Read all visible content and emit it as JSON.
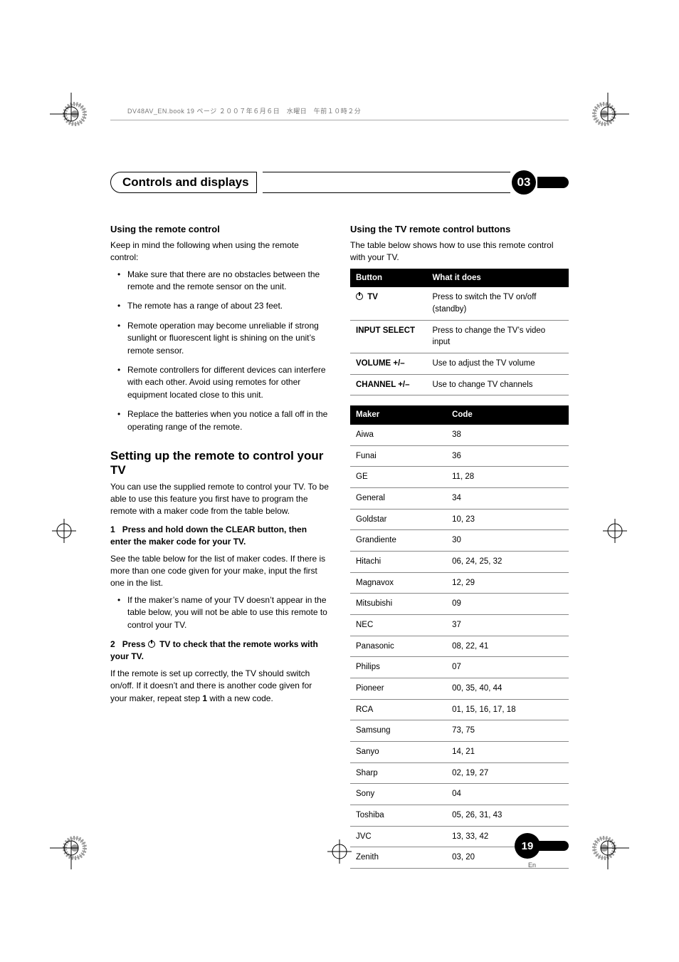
{
  "book_line": "DV48AV_EN.book  19 ページ  ２００７年６月６日　水曜日　午前１０時２分",
  "header": {
    "title": "Controls and displays",
    "chapter": "03"
  },
  "left": {
    "h_remote": "Using the remote control",
    "p_remote": "Keep in mind the following when using the remote control:",
    "bullets": [
      "Make sure that there are no obstacles between the remote and the remote sensor on the unit.",
      "The remote has a range of about 23 feet.",
      "Remote operation may become unreliable if strong sunlight or fluorescent light is shining on the unit’s remote sensor.",
      "Remote controllers for different devices can interfere with each other. Avoid using remotes for other equipment located close to this unit.",
      "Replace the batteries when you notice a fall off in the operating range of the remote."
    ],
    "h_setup": "Setting up the remote to control your TV",
    "p_setup": "You can use the supplied remote to control your TV. To be able to use this feature you first have to program the remote with a maker code from the table below.",
    "step1_num": "1",
    "step1_b": "Press and hold down the CLEAR button, then enter the maker code for your TV.",
    "step1_p": "See the table below for the list of maker codes. If there is more than one code given for your make, input the first one in the list.",
    "step1_bullet": "If the maker’s name of your TV doesn’t appear in the table below, you will not be able to use this remote to control your TV.",
    "step2_num": "2",
    "step2_pre": "Press ",
    "step2_b": " TV to check that the remote works with your TV.",
    "step2_p1": "If the remote is set up correctly, the TV should switch on/off. If it doesn’t and there is another code given for your maker, repeat step ",
    "step2_bold1": "1",
    "step2_p2": " with a new code."
  },
  "right": {
    "h_tvbtn": "Using the TV remote control buttons",
    "p_tvbtn": "The table below shows how to use this remote control with your TV.",
    "btn_th1": "Button",
    "btn_th2": "What it does",
    "btn_rows": [
      {
        "k": " TV",
        "v": "Press to switch the TV on/off (standby)",
        "pwr": true
      },
      {
        "k": "INPUT SELECT",
        "v": "Press to change the TV’s video input"
      },
      {
        "k": "VOLUME +/–",
        "v": "Use to adjust the TV volume"
      },
      {
        "k": "CHANNEL +/–",
        "v": "Use to change TV channels"
      }
    ],
    "mk_th1": "Maker",
    "mk_th2": "Code",
    "mk_rows": [
      {
        "k": "Aiwa",
        "v": "38"
      },
      {
        "k": "Funai",
        "v": "36"
      },
      {
        "k": "GE",
        "v": "11, 28"
      },
      {
        "k": "General",
        "v": "34"
      },
      {
        "k": "Goldstar",
        "v": "10, 23"
      },
      {
        "k": "Grandiente",
        "v": "30"
      },
      {
        "k": "Hitachi",
        "v": "06, 24, 25, 32"
      },
      {
        "k": "Magnavox",
        "v": "12, 29"
      },
      {
        "k": "Mitsubishi",
        "v": "09"
      },
      {
        "k": "NEC",
        "v": "37"
      },
      {
        "k": "Panasonic",
        "v": "08, 22, 41"
      },
      {
        "k": "Philips",
        "v": "07"
      },
      {
        "k": "Pioneer",
        "v": "00, 35, 40, 44"
      },
      {
        "k": "RCA",
        "v": "01, 15, 16, 17, 18"
      },
      {
        "k": "Samsung",
        "v": "73, 75"
      },
      {
        "k": "Sanyo",
        "v": "14, 21"
      },
      {
        "k": "Sharp",
        "v": "02, 19, 27"
      },
      {
        "k": "Sony",
        "v": "04"
      },
      {
        "k": "Toshiba",
        "v": "05, 26, 31, 43"
      },
      {
        "k": "JVC",
        "v": "13, 33, 42"
      },
      {
        "k": "Zenith",
        "v": "03, 20"
      }
    ]
  },
  "page": {
    "num": "19",
    "lang": "En"
  }
}
